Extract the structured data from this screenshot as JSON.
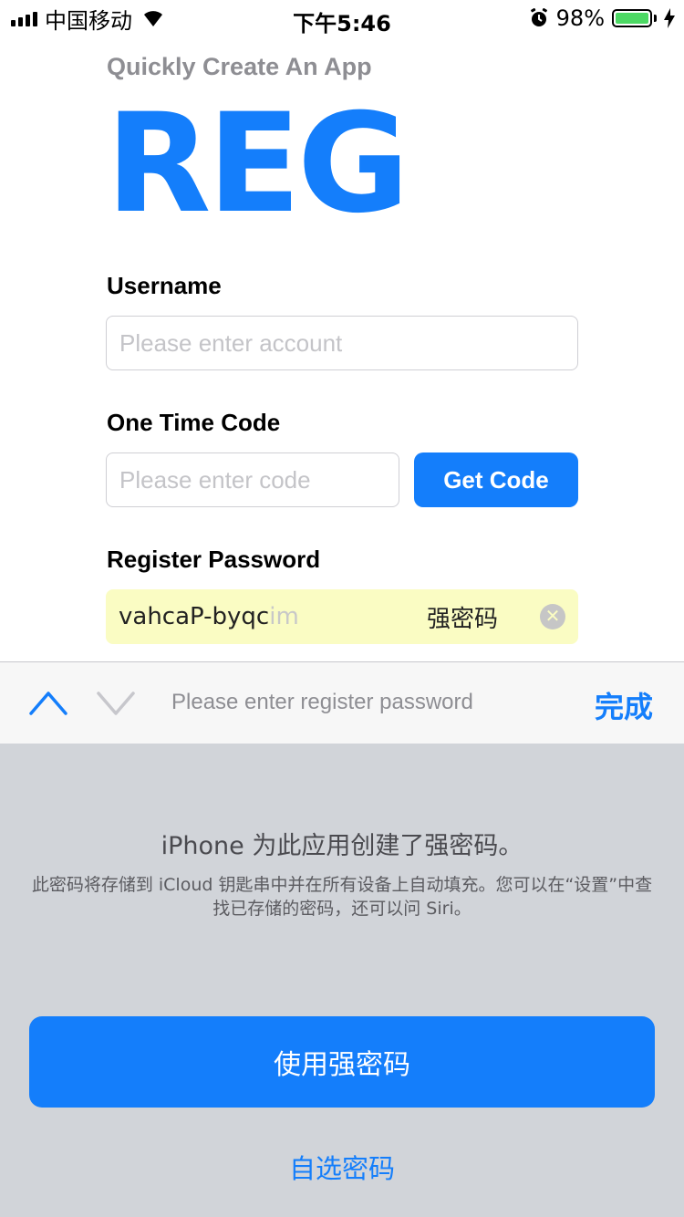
{
  "status_bar": {
    "carrier": "中国移动",
    "time": "下午5:46",
    "battery": "98%",
    "battery_level": 0.98
  },
  "app": {
    "subtitle": "Quickly Create An App",
    "logo": "REG",
    "accent_color": "#147efb"
  },
  "form": {
    "username_label": "Username",
    "username_placeholder": "Please enter account",
    "code_label": "One Time Code",
    "code_placeholder": "Please enter code",
    "get_code_label": "Get Code",
    "password_label": "Register Password",
    "password_value_visible": "vahcaP-byqc",
    "password_value_faded": "im",
    "strong_password_tag": "强密码"
  },
  "toolbar": {
    "hint": "Please enter register password",
    "done_label": "完成"
  },
  "sheet": {
    "title": "iPhone 为此应用创建了强密码。",
    "description": "此密码将存储到 iCloud 钥匙串中并在所有设备上自动填充。您可以在“设置”中查找已存储的密码，还可以问 Siri。",
    "use_strong_label": "使用强密码",
    "choose_own_label": "自选密码"
  }
}
